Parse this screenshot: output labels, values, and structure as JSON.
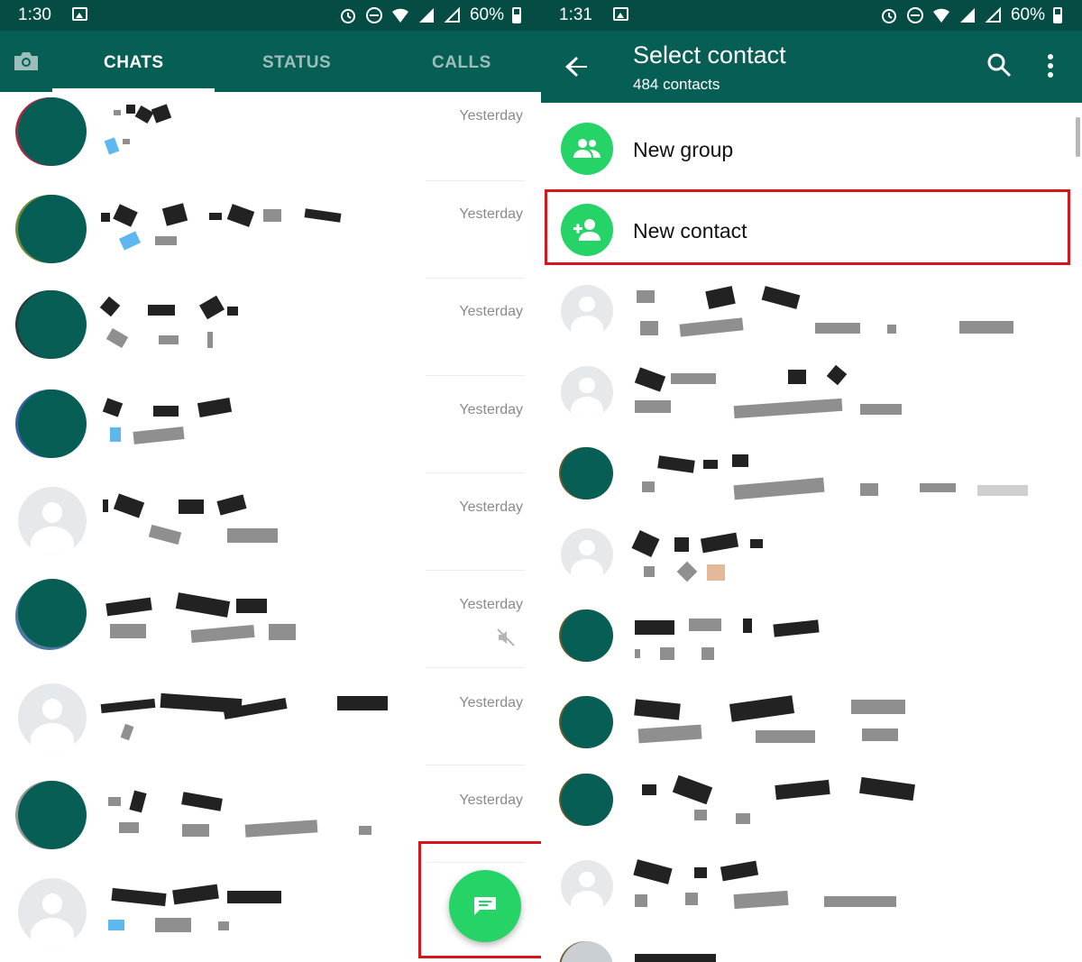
{
  "left": {
    "status_bar": {
      "time": "1:30",
      "battery": "60%"
    },
    "tabs": [
      {
        "label": "CHATS"
      },
      {
        "label": "STATUS"
      },
      {
        "label": "CALLS"
      }
    ],
    "chats": [
      {
        "time": "Yesterday",
        "muted": false
      },
      {
        "time": "Yesterday",
        "muted": false
      },
      {
        "time": "Yesterday",
        "muted": false
      },
      {
        "time": "Yesterday",
        "muted": false
      },
      {
        "time": "Yesterday",
        "muted": false
      },
      {
        "time": "Yesterday",
        "muted": true
      },
      {
        "time": "Yesterday",
        "muted": false
      },
      {
        "time": "Yesterday",
        "muted": false
      },
      {
        "time": "",
        "muted": false
      }
    ]
  },
  "right": {
    "status_bar": {
      "time": "1:31",
      "battery": "60%"
    },
    "toolbar": {
      "title": "Select contact",
      "subtitle": "484 contacts"
    },
    "actions": [
      {
        "label": "New group"
      },
      {
        "label": "New contact"
      }
    ]
  },
  "colors": {
    "header": "#075e54",
    "status_bar": "#054d44",
    "accent": "#25d366",
    "highlight": "#d4161c"
  },
  "icons": [
    "camera-icon",
    "back-icon",
    "search-icon",
    "more-vert-icon",
    "new-chat-icon",
    "group-icon",
    "person-add-icon",
    "mute-icon"
  ]
}
